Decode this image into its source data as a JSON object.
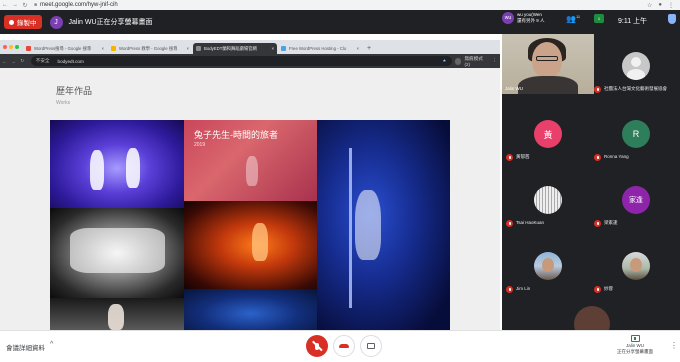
{
  "outer_browser": {
    "url": "meet.google.com/hyw-jnif-cih"
  },
  "meet": {
    "recording_label": "錄製中",
    "presenter_initial": "J",
    "presenting_text": "Jalin WU正在分享螢幕畫面",
    "you": {
      "initials": "wu",
      "line1": "wu you(Wen",
      "line2": "還有另外 9 人"
    },
    "participants_count": "11",
    "chat_badge": "1",
    "clock": "9:11 上午"
  },
  "shared_browser": {
    "tabs": [
      {
        "label": "WordPress搜尋 - Google 搜尋",
        "fav": "#e8453c",
        "active": false
      },
      {
        "label": "WordPress 教學 - Google 搜尋",
        "fav": "#f6b400",
        "active": false
      },
      {
        "label": "BodyEDT蘭和舞蹈劇場官網",
        "fav": "#8a8a8a",
        "active": true
      },
      {
        "label": "Free WordPress Hosting - Clo",
        "fav": "#4aa3df",
        "active": false
      }
    ],
    "new_tab": "+",
    "insecure_label": "不安全",
    "url": "bodyedt.com",
    "incognito_label": "無痕模式 (2)",
    "page": {
      "title": "歷年作品",
      "subtitle": "Works",
      "featured_work_title": "兔子先生-時間的旅者",
      "featured_work_year": "2019"
    }
  },
  "panel": {
    "self_name": "Jalin WU",
    "participants": [
      {
        "name": "社團法人台灣文化藝術發展協會",
        "initial": "",
        "color": "",
        "photo": "generic"
      },
      {
        "name": "黃郁茜",
        "initial": "黃",
        "color": "#e8406a",
        "photo": ""
      },
      {
        "name": "Ronna Yang",
        "initial": "R",
        "color": "#2e7d5b",
        "photo": ""
      },
      {
        "name": "Tsai HaoKuan",
        "initial": "",
        "color": "",
        "photo": "zebra"
      },
      {
        "name": "梁家逢",
        "initial": "家逢",
        "color": "#8e24aa",
        "photo": ""
      },
      {
        "name": "Jim Lin",
        "initial": "",
        "color": "",
        "photo": "man"
      },
      {
        "name": "妙蓉",
        "initial": "",
        "color": "",
        "photo": "man2"
      }
    ]
  },
  "bottom": {
    "meeting_details": "會議詳細資料",
    "present_line1": "Jalin WU",
    "present_line2": "正在分享螢幕畫面"
  }
}
